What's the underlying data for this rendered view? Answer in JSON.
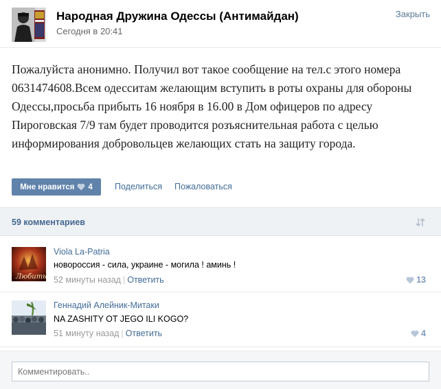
{
  "header": {
    "group_title": "Народная Дружина Одессы (Антимайдан)",
    "post_date": "Сегодня в 20:41",
    "close_label": "Закрыть"
  },
  "post": {
    "text": "Пожалуйста анонимно. Получил вот такое сообщение на тел.с этого номера 0631474608.Всем одесситам желающим вступить в роты охраны для обороны Одессы,просьба прибыть 16 ноября в 16.00 в Дом офицеров по адресу Пироговская 7/9 там будет проводится розъяснительная работа с целью информирования добровольцев желающих стать на защиту города.",
    "like_label": "Мне нравится",
    "like_count": "4",
    "share_label": "Поделиться",
    "report_label": "Пожаловаться"
  },
  "comments_header": {
    "count_label": "59 комментариев"
  },
  "comments": [
    {
      "author": "Viola La-Patria",
      "text": "новороссия - сила, украине - могила ! аминь !",
      "time": "52 минуты назад",
      "reply_label": "Ответить",
      "likes": "13",
      "avatar_caption": "Любить"
    },
    {
      "author": "Геннадий Алейник-Митаки",
      "text": "NA ZASHITY OT JEGO ILI KOGO?",
      "time": "51 минуту назад",
      "reply_label": "Ответить",
      "likes": "4"
    }
  ],
  "footer": {
    "input_placeholder": "Комментировать.."
  },
  "colors": {
    "link": "#426c98",
    "button": "#6083ab",
    "comments_bar_bg": "#eff2f5",
    "like_heart": "#7f9ab8"
  }
}
